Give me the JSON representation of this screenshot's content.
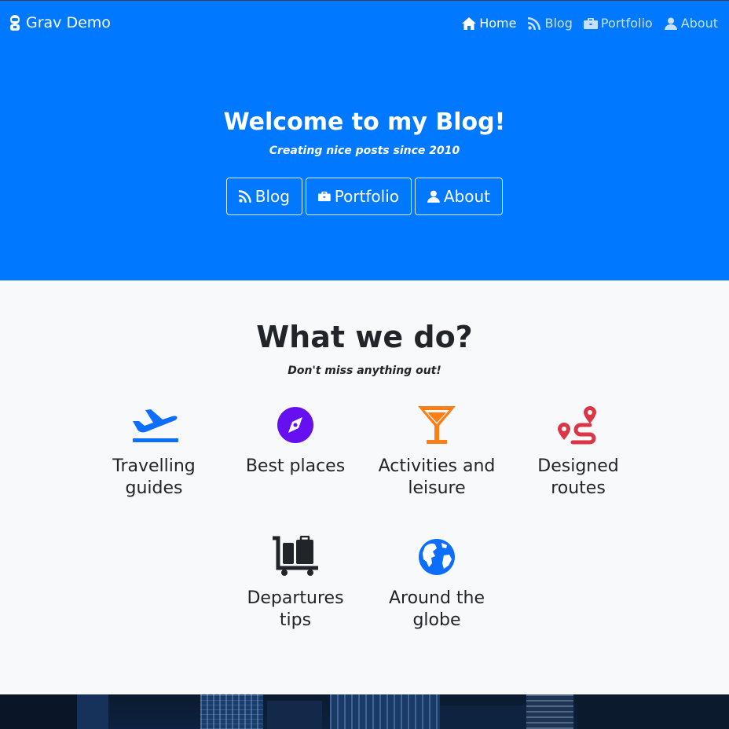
{
  "navbar": {
    "brand": "Grav Demo",
    "links": [
      {
        "label": "Home",
        "icon": "home-icon",
        "active": true
      },
      {
        "label": "Blog",
        "icon": "rss-icon",
        "active": false
      },
      {
        "label": "Portfolio",
        "icon": "briefcase-icon",
        "active": false
      },
      {
        "label": "About",
        "icon": "user-icon",
        "active": false
      }
    ]
  },
  "hero": {
    "title": "Welcome to my Blog!",
    "subtitle": "Creating nice posts since 2010",
    "buttons": [
      {
        "label": "Blog",
        "icon": "rss-icon"
      },
      {
        "label": "Portfolio",
        "icon": "briefcase-icon"
      },
      {
        "label": "About",
        "icon": "user-icon"
      }
    ]
  },
  "section": {
    "title": "What we do?",
    "subtitle": "Don't miss anything out!",
    "features": [
      {
        "label": "Travelling guides",
        "icon": "plane-departure-icon",
        "color": "#0d6efd"
      },
      {
        "label": "Best places",
        "icon": "compass-icon",
        "color": "#6610f2"
      },
      {
        "label": "Activities and leisure",
        "icon": "cocktail-icon",
        "color": "#fd7e14"
      },
      {
        "label": "Designed routes",
        "icon": "route-icon",
        "color": "#dc3545"
      },
      {
        "label": "Departures tips",
        "icon": "luggage-cart-icon",
        "color": "#212529"
      },
      {
        "label": "Around the globe",
        "icon": "globe-icon",
        "color": "#0d6efd"
      }
    ]
  },
  "colors": {
    "primary": "#0078ff",
    "background": "#f8f9fa",
    "text": "#212529"
  }
}
